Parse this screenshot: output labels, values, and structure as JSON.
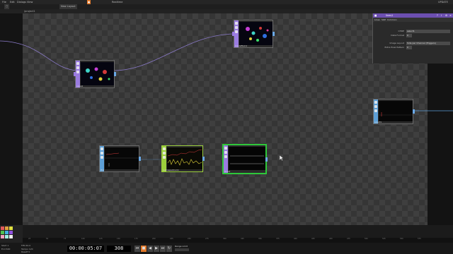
{
  "menubar": {
    "items": [
      "File",
      "Edit",
      "Dialogs",
      "View",
      "",
      "",
      "",
      "",
      "",
      "",
      "",
      "",
      "",
      "",
      "Realtime"
    ],
    "realtime_label": "Realtime",
    "build": "UPDATE"
  },
  "toolbar": {
    "tab_label": "New Layout",
    "path": "/project1"
  },
  "panel": {
    "title": "lines1",
    "tabs": [
      "Lines",
      "SOP",
      "Common"
    ],
    "rows": [
      {
        "key": "CHOP",
        "value": "select1"
      },
      {
        "key": "Data Format",
        "value": "0"
      },
      {
        "key": "Image Layout",
        "value": "Side per Channel (Triggers)"
      },
      {
        "key": "Extra Pixel Pattern",
        "value": "0"
      }
    ]
  },
  "nodes": [
    {
      "id": "noise1",
      "label": "noise1"
    },
    {
      "id": "moviefilein1",
      "label": "moviefilein1"
    },
    {
      "id": "select1",
      "label": "select1"
    },
    {
      "id": "lfo1",
      "label": "lfo1"
    },
    {
      "id": "audiospectrum1",
      "label": "audiospectrum1"
    },
    {
      "id": "lines1",
      "label": "lines1"
    }
  ],
  "transport": {
    "timecode": "00:00:05:07",
    "frame": "308",
    "range_label": "Range Limit"
  },
  "stats": [
    {
      "label": "Start",
      "value": "1"
    },
    {
      "label": "End",
      "value": "600"
    },
    {
      "label": "FPS",
      "value": "60.0"
    },
    {
      "label": "Tempo",
      "value": "120"
    },
    {
      "label": "Resetf",
      "value": "0"
    }
  ],
  "timeline_ticks": [
    "25",
    "50",
    "75",
    "100",
    "125",
    "150",
    "175",
    "200",
    "225",
    "250",
    "275",
    "300",
    "325",
    "350",
    "375",
    "400",
    "425",
    "450",
    "475",
    "500",
    "525",
    "550",
    "575"
  ],
  "colors": {
    "accent": "#e0782a",
    "panel_header": "#6c4fb0",
    "top_purple": "#9a7be0",
    "chop_green": "#9ccf3c",
    "chop_blue": "#5d9fd6",
    "wire": "#8a7ac8",
    "selected": "#2ec83a"
  }
}
